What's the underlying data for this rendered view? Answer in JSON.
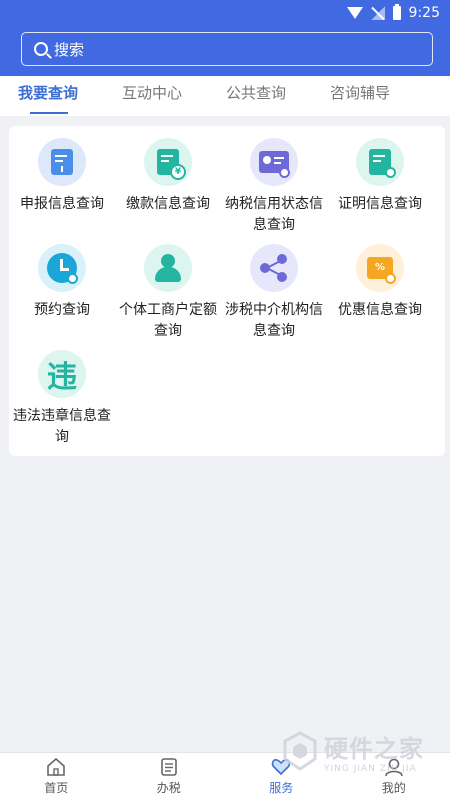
{
  "status_bar": {
    "time": "9:25"
  },
  "search": {
    "placeholder": "搜索"
  },
  "tabs": [
    {
      "label": "我要查询",
      "active": true
    },
    {
      "label": "互动中心",
      "active": false
    },
    {
      "label": "公共查询",
      "active": false
    },
    {
      "label": "咨询辅导",
      "active": false
    }
  ],
  "grid": {
    "items": [
      {
        "label": "申报信息查询",
        "icon": "declare-doc-icon"
      },
      {
        "label": "缴款信息查询",
        "icon": "payment-doc-icon"
      },
      {
        "label": "纳税信用状态信息查询",
        "icon": "credit-card-icon"
      },
      {
        "label": "证明信息查询",
        "icon": "certificate-doc-icon"
      },
      {
        "label": "预约查询",
        "icon": "clock-icon"
      },
      {
        "label": "个体工商户定额查询",
        "icon": "person-icon"
      },
      {
        "label": "涉税中介机构信息查询",
        "icon": "share-network-icon"
      },
      {
        "label": "优惠信息查询",
        "icon": "coupon-icon"
      },
      {
        "label": "违法违章信息查询",
        "icon": "violation-icon",
        "glyph": "违"
      }
    ]
  },
  "bottom_nav": [
    {
      "label": "首页",
      "icon": "home-icon",
      "active": false
    },
    {
      "label": "办税",
      "icon": "list-icon",
      "active": false
    },
    {
      "label": "服务",
      "icon": "heart-icon",
      "active": true
    },
    {
      "label": "我的",
      "icon": "user-icon",
      "active": false
    }
  ],
  "watermark": {
    "title": "硬件之家",
    "subtitle": "YING JIAN ZHI JIA"
  },
  "colors": {
    "header": "#4169e1",
    "accent": "#3b6fd6",
    "teal": "#23b5a0",
    "purple": "#6d6ad8",
    "orange": "#f5a623"
  }
}
